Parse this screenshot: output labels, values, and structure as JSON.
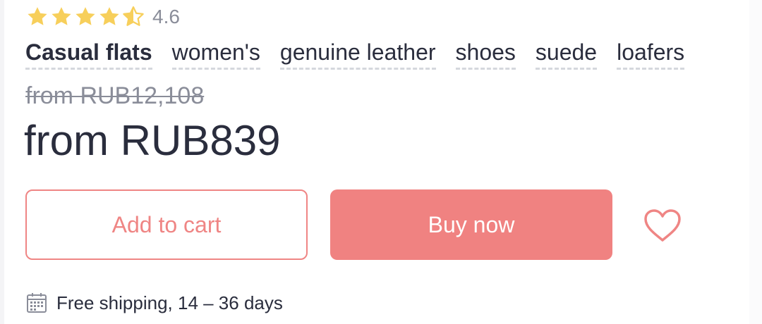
{
  "colors": {
    "star": "#f7cf5b",
    "star_empty": "#f7cf5b",
    "accent": "#ef8584",
    "accent_fill": "#f08281",
    "text": "#2a2d3d",
    "muted": "#8a8d99"
  },
  "rating": {
    "value": "4.6",
    "stars_filled": 4.5,
    "stars_total": 5,
    "icon": "star-icon"
  },
  "tags": [
    {
      "label": "Casual flats"
    },
    {
      "label": "women's"
    },
    {
      "label": "genuine leather"
    },
    {
      "label": "shoes"
    },
    {
      "label": "suede"
    },
    {
      "label": "loafers"
    }
  ],
  "price": {
    "original": "from RUB12,108",
    "current": "from RUB839"
  },
  "actions": {
    "add_to_cart": "Add to cart",
    "buy_now": "Buy now",
    "wishlist_icon": "heart-icon"
  },
  "shipping": {
    "icon": "calendar-icon",
    "text": "Free shipping, 14 – 36 days"
  }
}
